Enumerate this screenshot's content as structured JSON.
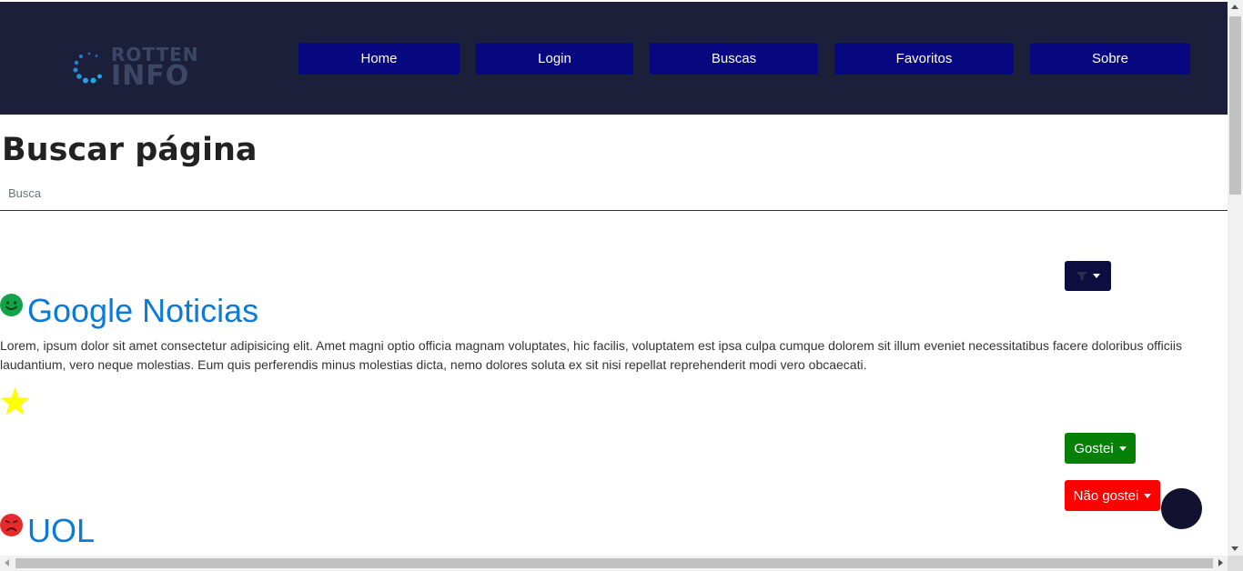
{
  "header": {
    "logo": {
      "line1": "ROTTEN",
      "line2": "INFO"
    },
    "nav": [
      "Home",
      "Login",
      "Buscas",
      "Favoritos",
      "Sobre"
    ]
  },
  "page": {
    "title": "Buscar página",
    "breadcrumb": "Busca"
  },
  "filter_button": {
    "icon": "filter-icon"
  },
  "results": [
    {
      "icon": "smile-icon",
      "title": "Google Noticias",
      "description": "Lorem, ipsum dolor sit amet consectetur adipisicing elit. Amet magni optio officia magnam voluptates, hic facilis, voluptatem est ipsa culpa cumque dolorem sit illum eveniet necessitatibus facere doloribus officiis laudantium, vero neque molestias. Eum quis perferendis minus molestias dicta, nemo dolores soluta ex sit nisi repellat reprehenderit modi vero obcaecati.",
      "favorite": "star-icon"
    },
    {
      "icon": "sad-icon",
      "title": "UOL"
    }
  ],
  "actions": {
    "like": "Gostei",
    "dislike": "Não gostei"
  },
  "colors": {
    "navbar_bg": "#1c1f3a",
    "nav_button": "#07077f",
    "link": "#0a7bd8",
    "like": "#068006",
    "dislike": "#ff0000",
    "star": "#ffff00",
    "smile": "#12a34a",
    "sad": "#e52b2b"
  }
}
